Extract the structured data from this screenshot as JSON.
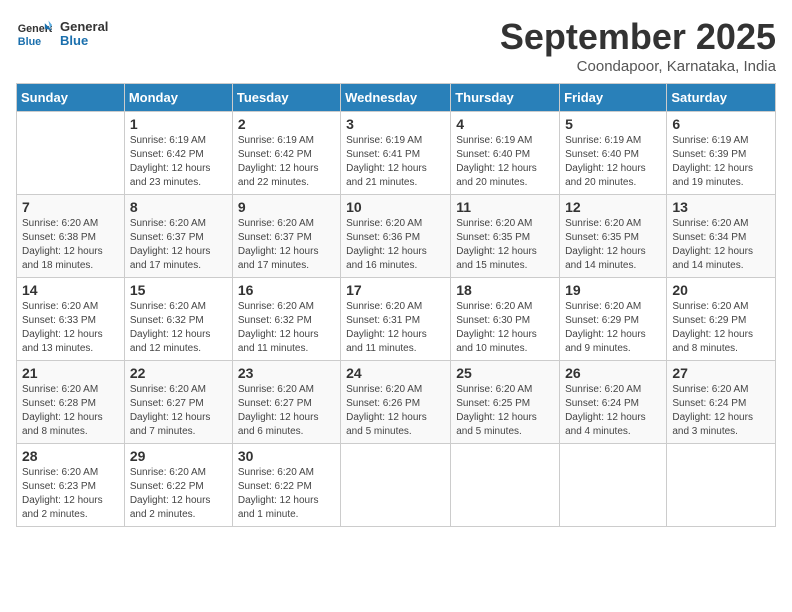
{
  "logo": {
    "line1": "General",
    "line2": "Blue"
  },
  "title": "September 2025",
  "subtitle": "Coondapoor, Karnataka, India",
  "days_of_week": [
    "Sunday",
    "Monday",
    "Tuesday",
    "Wednesday",
    "Thursday",
    "Friday",
    "Saturday"
  ],
  "weeks": [
    [
      {
        "day": "",
        "info": ""
      },
      {
        "day": "1",
        "info": "Sunrise: 6:19 AM\nSunset: 6:42 PM\nDaylight: 12 hours\nand 23 minutes."
      },
      {
        "day": "2",
        "info": "Sunrise: 6:19 AM\nSunset: 6:42 PM\nDaylight: 12 hours\nand 22 minutes."
      },
      {
        "day": "3",
        "info": "Sunrise: 6:19 AM\nSunset: 6:41 PM\nDaylight: 12 hours\nand 21 minutes."
      },
      {
        "day": "4",
        "info": "Sunrise: 6:19 AM\nSunset: 6:40 PM\nDaylight: 12 hours\nand 20 minutes."
      },
      {
        "day": "5",
        "info": "Sunrise: 6:19 AM\nSunset: 6:40 PM\nDaylight: 12 hours\nand 20 minutes."
      },
      {
        "day": "6",
        "info": "Sunrise: 6:19 AM\nSunset: 6:39 PM\nDaylight: 12 hours\nand 19 minutes."
      }
    ],
    [
      {
        "day": "7",
        "info": "Sunrise: 6:20 AM\nSunset: 6:38 PM\nDaylight: 12 hours\nand 18 minutes."
      },
      {
        "day": "8",
        "info": "Sunrise: 6:20 AM\nSunset: 6:37 PM\nDaylight: 12 hours\nand 17 minutes."
      },
      {
        "day": "9",
        "info": "Sunrise: 6:20 AM\nSunset: 6:37 PM\nDaylight: 12 hours\nand 17 minutes."
      },
      {
        "day": "10",
        "info": "Sunrise: 6:20 AM\nSunset: 6:36 PM\nDaylight: 12 hours\nand 16 minutes."
      },
      {
        "day": "11",
        "info": "Sunrise: 6:20 AM\nSunset: 6:35 PM\nDaylight: 12 hours\nand 15 minutes."
      },
      {
        "day": "12",
        "info": "Sunrise: 6:20 AM\nSunset: 6:35 PM\nDaylight: 12 hours\nand 14 minutes."
      },
      {
        "day": "13",
        "info": "Sunrise: 6:20 AM\nSunset: 6:34 PM\nDaylight: 12 hours\nand 14 minutes."
      }
    ],
    [
      {
        "day": "14",
        "info": "Sunrise: 6:20 AM\nSunset: 6:33 PM\nDaylight: 12 hours\nand 13 minutes."
      },
      {
        "day": "15",
        "info": "Sunrise: 6:20 AM\nSunset: 6:32 PM\nDaylight: 12 hours\nand 12 minutes."
      },
      {
        "day": "16",
        "info": "Sunrise: 6:20 AM\nSunset: 6:32 PM\nDaylight: 12 hours\nand 11 minutes."
      },
      {
        "day": "17",
        "info": "Sunrise: 6:20 AM\nSunset: 6:31 PM\nDaylight: 12 hours\nand 11 minutes."
      },
      {
        "day": "18",
        "info": "Sunrise: 6:20 AM\nSunset: 6:30 PM\nDaylight: 12 hours\nand 10 minutes."
      },
      {
        "day": "19",
        "info": "Sunrise: 6:20 AM\nSunset: 6:29 PM\nDaylight: 12 hours\nand 9 minutes."
      },
      {
        "day": "20",
        "info": "Sunrise: 6:20 AM\nSunset: 6:29 PM\nDaylight: 12 hours\nand 8 minutes."
      }
    ],
    [
      {
        "day": "21",
        "info": "Sunrise: 6:20 AM\nSunset: 6:28 PM\nDaylight: 12 hours\nand 8 minutes."
      },
      {
        "day": "22",
        "info": "Sunrise: 6:20 AM\nSunset: 6:27 PM\nDaylight: 12 hours\nand 7 minutes."
      },
      {
        "day": "23",
        "info": "Sunrise: 6:20 AM\nSunset: 6:27 PM\nDaylight: 12 hours\nand 6 minutes."
      },
      {
        "day": "24",
        "info": "Sunrise: 6:20 AM\nSunset: 6:26 PM\nDaylight: 12 hours\nand 5 minutes."
      },
      {
        "day": "25",
        "info": "Sunrise: 6:20 AM\nSunset: 6:25 PM\nDaylight: 12 hours\nand 5 minutes."
      },
      {
        "day": "26",
        "info": "Sunrise: 6:20 AM\nSunset: 6:24 PM\nDaylight: 12 hours\nand 4 minutes."
      },
      {
        "day": "27",
        "info": "Sunrise: 6:20 AM\nSunset: 6:24 PM\nDaylight: 12 hours\nand 3 minutes."
      }
    ],
    [
      {
        "day": "28",
        "info": "Sunrise: 6:20 AM\nSunset: 6:23 PM\nDaylight: 12 hours\nand 2 minutes."
      },
      {
        "day": "29",
        "info": "Sunrise: 6:20 AM\nSunset: 6:22 PM\nDaylight: 12 hours\nand 2 minutes."
      },
      {
        "day": "30",
        "info": "Sunrise: 6:20 AM\nSunset: 6:22 PM\nDaylight: 12 hours\nand 1 minute."
      },
      {
        "day": "",
        "info": ""
      },
      {
        "day": "",
        "info": ""
      },
      {
        "day": "",
        "info": ""
      },
      {
        "day": "",
        "info": ""
      }
    ]
  ]
}
